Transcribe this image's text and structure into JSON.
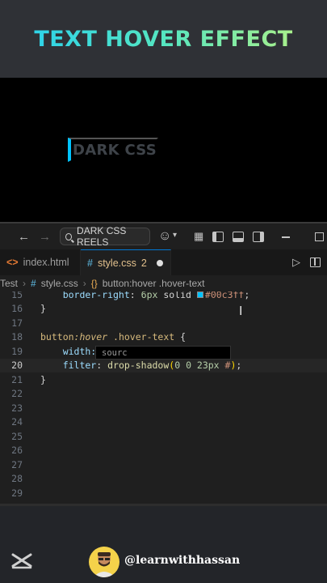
{
  "banner": {
    "title": "TEXT HOVER EFFECT"
  },
  "preview": {
    "demo_text": "DARK CSS",
    "accent_color": "#00c3ff"
  },
  "titlebar": {
    "command_center_label": "DARK CSS REELS",
    "icons": [
      "back-arrow-icon",
      "forward-arrow-icon",
      "search-icon",
      "copilot-icon",
      "chevron-down-icon",
      "layout-customize-icon",
      "toggle-sidebar-icon",
      "toggle-panel-icon",
      "toggle-secondary-sidebar-icon",
      "minimize-icon",
      "maximize-icon"
    ]
  },
  "tabs": [
    {
      "label": "index.html",
      "icon": "html-icon",
      "active": false
    },
    {
      "label": "style.css",
      "icon": "css-icon",
      "active": true,
      "problems": "2"
    }
  ],
  "breadcrumb": {
    "folder": "Test",
    "file": "style.css",
    "symbol": "button:hover .hover-text"
  },
  "editor": {
    "lines": [
      {
        "n": "15",
        "text": "    border-right: 6px solid #00c3ff;"
      },
      {
        "n": "16",
        "text": "}"
      },
      {
        "n": "17",
        "text": ""
      },
      {
        "n": "18",
        "text": "button:hover .hover-text {"
      },
      {
        "n": "19",
        "text": "    width:"
      },
      {
        "n": "20",
        "text": "    filter: drop-shadow(0 0 23px #);"
      },
      {
        "n": "21",
        "text": "}"
      },
      {
        "n": "22",
        "text": ""
      },
      {
        "n": "23",
        "text": ""
      },
      {
        "n": "24",
        "text": ""
      },
      {
        "n": "25",
        "text": ""
      },
      {
        "n": "26",
        "text": ""
      },
      {
        "n": "27",
        "text": ""
      },
      {
        "n": "28",
        "text": ""
      },
      {
        "n": "29",
        "text": ""
      }
    ],
    "current_line": "20",
    "suggestion_text": "sourc"
  },
  "footer": {
    "handle": "@learnwithhassan",
    "logo": "capcut-logo-icon"
  }
}
